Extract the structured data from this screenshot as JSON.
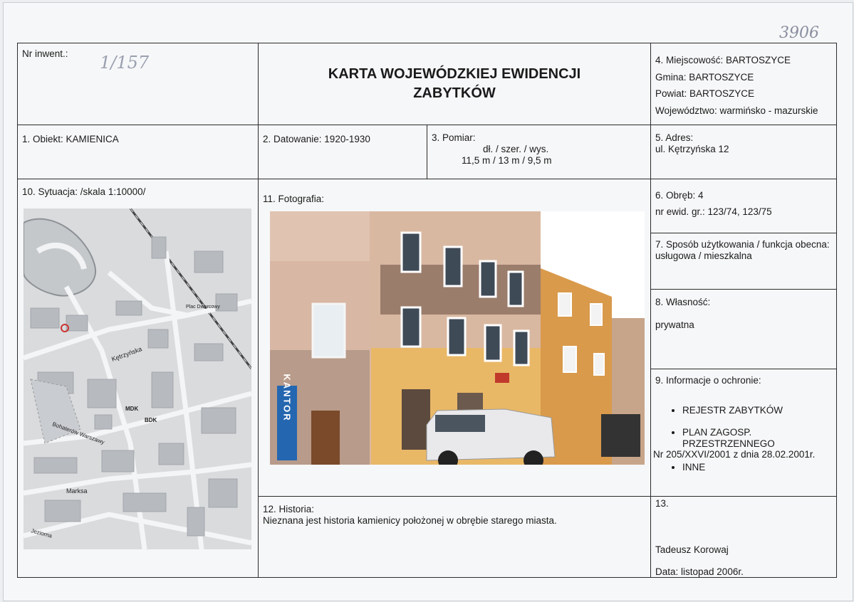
{
  "corner_number": "3906",
  "nr_inwent": {
    "label": "Nr inwent.:",
    "value": "1/157"
  },
  "title": {
    "line1": "KARTA WOJEWÓDZKIEJ EWIDENCJI",
    "line2": "ZABYTKÓW"
  },
  "location": {
    "miejscowosc": "4. Miejscowość: BARTOSZYCE",
    "gmina": "Gmina: BARTOSZYCE",
    "powiat": "Powiat: BARTOSZYCE",
    "wojewodztwo": "Województwo: warmińsko - mazurskie"
  },
  "obiekt": "1. Obiekt: KAMIENICA",
  "datowanie": "2. Datowanie: 1920-1930",
  "pomiar": {
    "label": "3. Pomiar:",
    "dims_label": "dł. / szer. / wys.",
    "dims_value": "11,5 m / 13 m / 9,5 m"
  },
  "adres": {
    "label": "5. Adres:",
    "value": "ul. Kętrzyńska 12"
  },
  "sytuacja": "10. Sytuacja: /skala 1:10000/",
  "fotografia": "11. Fotografia:",
  "obreb": {
    "label": "6. Obręb: 4",
    "ewid": "nr ewid. gr.: 123/74, 123/75"
  },
  "sposob": {
    "label": "7. Sposób użytkowania / funkcja obecna:",
    "value": "usługowa / mieszkalna"
  },
  "wlasnosc": {
    "label": "8. Własność:",
    "value": "prywatna"
  },
  "ochrona": {
    "label": "9. Informacje o ochronie:",
    "item1": "REJESTR ZABYTKÓW",
    "item2": "PLAN ZAGOSP. PRZESTRZENNEGO",
    "item2_note": "Nr 205/XXVI/2001 z dnia 28.02.2001r.",
    "item3": "INNE"
  },
  "historia": {
    "label": "12. Historia:",
    "value": "Nieznana jest historia kamienicy położonej w obrębie starego miasta."
  },
  "box13": {
    "label": "13.",
    "author": "Tadeusz Korowaj",
    "date": "Data: listopad 2006r."
  },
  "photo": {
    "sign_kantor": "KANTOR"
  },
  "map_labels": {
    "street1": "Kętrzyńska",
    "street2": "Marksa",
    "street3": "Bohaterów Warszawy",
    "street4": "Jeziorna",
    "street5": "Plac Dworcowy",
    "bdk": "BDK",
    "mdk": "MDK"
  },
  "colors": {
    "border": "#2b2b2b",
    "paper": "#f6f7f8"
  }
}
